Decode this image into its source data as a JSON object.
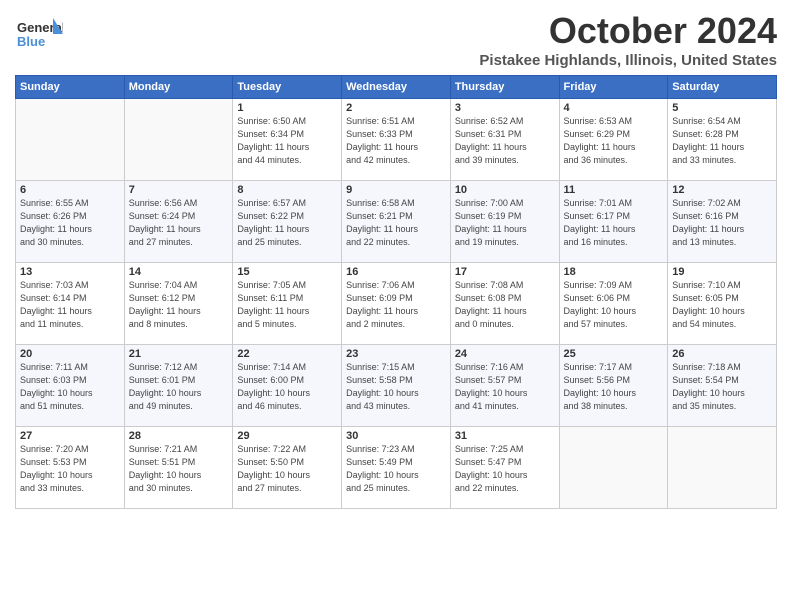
{
  "header": {
    "logo_general": "General",
    "logo_blue": "Blue",
    "month": "October 2024",
    "location": "Pistakee Highlands, Illinois, United States"
  },
  "weekdays": [
    "Sunday",
    "Monday",
    "Tuesday",
    "Wednesday",
    "Thursday",
    "Friday",
    "Saturday"
  ],
  "weeks": [
    [
      {
        "day": "",
        "info": ""
      },
      {
        "day": "",
        "info": ""
      },
      {
        "day": "1",
        "info": "Sunrise: 6:50 AM\nSunset: 6:34 PM\nDaylight: 11 hours\nand 44 minutes."
      },
      {
        "day": "2",
        "info": "Sunrise: 6:51 AM\nSunset: 6:33 PM\nDaylight: 11 hours\nand 42 minutes."
      },
      {
        "day": "3",
        "info": "Sunrise: 6:52 AM\nSunset: 6:31 PM\nDaylight: 11 hours\nand 39 minutes."
      },
      {
        "day": "4",
        "info": "Sunrise: 6:53 AM\nSunset: 6:29 PM\nDaylight: 11 hours\nand 36 minutes."
      },
      {
        "day": "5",
        "info": "Sunrise: 6:54 AM\nSunset: 6:28 PM\nDaylight: 11 hours\nand 33 minutes."
      }
    ],
    [
      {
        "day": "6",
        "info": "Sunrise: 6:55 AM\nSunset: 6:26 PM\nDaylight: 11 hours\nand 30 minutes."
      },
      {
        "day": "7",
        "info": "Sunrise: 6:56 AM\nSunset: 6:24 PM\nDaylight: 11 hours\nand 27 minutes."
      },
      {
        "day": "8",
        "info": "Sunrise: 6:57 AM\nSunset: 6:22 PM\nDaylight: 11 hours\nand 25 minutes."
      },
      {
        "day": "9",
        "info": "Sunrise: 6:58 AM\nSunset: 6:21 PM\nDaylight: 11 hours\nand 22 minutes."
      },
      {
        "day": "10",
        "info": "Sunrise: 7:00 AM\nSunset: 6:19 PM\nDaylight: 11 hours\nand 19 minutes."
      },
      {
        "day": "11",
        "info": "Sunrise: 7:01 AM\nSunset: 6:17 PM\nDaylight: 11 hours\nand 16 minutes."
      },
      {
        "day": "12",
        "info": "Sunrise: 7:02 AM\nSunset: 6:16 PM\nDaylight: 11 hours\nand 13 minutes."
      }
    ],
    [
      {
        "day": "13",
        "info": "Sunrise: 7:03 AM\nSunset: 6:14 PM\nDaylight: 11 hours\nand 11 minutes."
      },
      {
        "day": "14",
        "info": "Sunrise: 7:04 AM\nSunset: 6:12 PM\nDaylight: 11 hours\nand 8 minutes."
      },
      {
        "day": "15",
        "info": "Sunrise: 7:05 AM\nSunset: 6:11 PM\nDaylight: 11 hours\nand 5 minutes."
      },
      {
        "day": "16",
        "info": "Sunrise: 7:06 AM\nSunset: 6:09 PM\nDaylight: 11 hours\nand 2 minutes."
      },
      {
        "day": "17",
        "info": "Sunrise: 7:08 AM\nSunset: 6:08 PM\nDaylight: 11 hours\nand 0 minutes."
      },
      {
        "day": "18",
        "info": "Sunrise: 7:09 AM\nSunset: 6:06 PM\nDaylight: 10 hours\nand 57 minutes."
      },
      {
        "day": "19",
        "info": "Sunrise: 7:10 AM\nSunset: 6:05 PM\nDaylight: 10 hours\nand 54 minutes."
      }
    ],
    [
      {
        "day": "20",
        "info": "Sunrise: 7:11 AM\nSunset: 6:03 PM\nDaylight: 10 hours\nand 51 minutes."
      },
      {
        "day": "21",
        "info": "Sunrise: 7:12 AM\nSunset: 6:01 PM\nDaylight: 10 hours\nand 49 minutes."
      },
      {
        "day": "22",
        "info": "Sunrise: 7:14 AM\nSunset: 6:00 PM\nDaylight: 10 hours\nand 46 minutes."
      },
      {
        "day": "23",
        "info": "Sunrise: 7:15 AM\nSunset: 5:58 PM\nDaylight: 10 hours\nand 43 minutes."
      },
      {
        "day": "24",
        "info": "Sunrise: 7:16 AM\nSunset: 5:57 PM\nDaylight: 10 hours\nand 41 minutes."
      },
      {
        "day": "25",
        "info": "Sunrise: 7:17 AM\nSunset: 5:56 PM\nDaylight: 10 hours\nand 38 minutes."
      },
      {
        "day": "26",
        "info": "Sunrise: 7:18 AM\nSunset: 5:54 PM\nDaylight: 10 hours\nand 35 minutes."
      }
    ],
    [
      {
        "day": "27",
        "info": "Sunrise: 7:20 AM\nSunset: 5:53 PM\nDaylight: 10 hours\nand 33 minutes."
      },
      {
        "day": "28",
        "info": "Sunrise: 7:21 AM\nSunset: 5:51 PM\nDaylight: 10 hours\nand 30 minutes."
      },
      {
        "day": "29",
        "info": "Sunrise: 7:22 AM\nSunset: 5:50 PM\nDaylight: 10 hours\nand 27 minutes."
      },
      {
        "day": "30",
        "info": "Sunrise: 7:23 AM\nSunset: 5:49 PM\nDaylight: 10 hours\nand 25 minutes."
      },
      {
        "day": "31",
        "info": "Sunrise: 7:25 AM\nSunset: 5:47 PM\nDaylight: 10 hours\nand 22 minutes."
      },
      {
        "day": "",
        "info": ""
      },
      {
        "day": "",
        "info": ""
      }
    ]
  ]
}
